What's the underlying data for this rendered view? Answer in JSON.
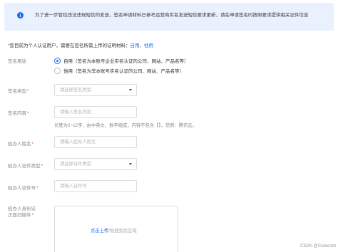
{
  "notice": {
    "icon": "info-circle-icon",
    "text": "为了进一步管控违法违规短信的发送，签名申请材料已参考运营商实名发送短信要求更新，请在申请签名时按照要求提供相关证件信息"
  },
  "hint": {
    "star": "*",
    "text": "您目前为个人认证用户，需要在签名所需上传的证明材料：",
    "link_self": "自用",
    "sep": "、",
    "link_other": "他用"
  },
  "form": {
    "usage": {
      "label": "签名用途",
      "options": [
        {
          "label": "自用（签名为本账号企业实名认证的公司、网站、产品名等）",
          "checked": true
        },
        {
          "label": "他用（签名为非本账号实名认证的公司、网站、产品名等）",
          "checked": false
        }
      ]
    },
    "sign_type": {
      "label": "签名类型",
      "required": "*",
      "placeholder": "请选择签名类型"
    },
    "sign_content": {
      "label": "签名内容",
      "required": "*",
      "placeholder": "请输入签名内容",
      "help": "长度为2~12字，由中英文、数字组成，内容不包含【】，范例：腾讯云。"
    },
    "agent_name": {
      "label": "经办人姓名",
      "required": "*",
      "placeholder": "请输入经办人姓名"
    },
    "agent_id_type": {
      "label": "经办人证件类型",
      "required": "*",
      "placeholder": "请选择证件类型"
    },
    "agent_id_number": {
      "label": "经办人证件号",
      "required": "*",
      "placeholder": "请输入证件号"
    },
    "agent_id_photo": {
      "label_line1": "经办人身份证",
      "label_line2": "正面扫描件",
      "required": "*",
      "upload_link": "点击上传",
      "upload_hint": "/拖拽到此区域"
    }
  },
  "watermark": "CSDN @Coderxzh"
}
